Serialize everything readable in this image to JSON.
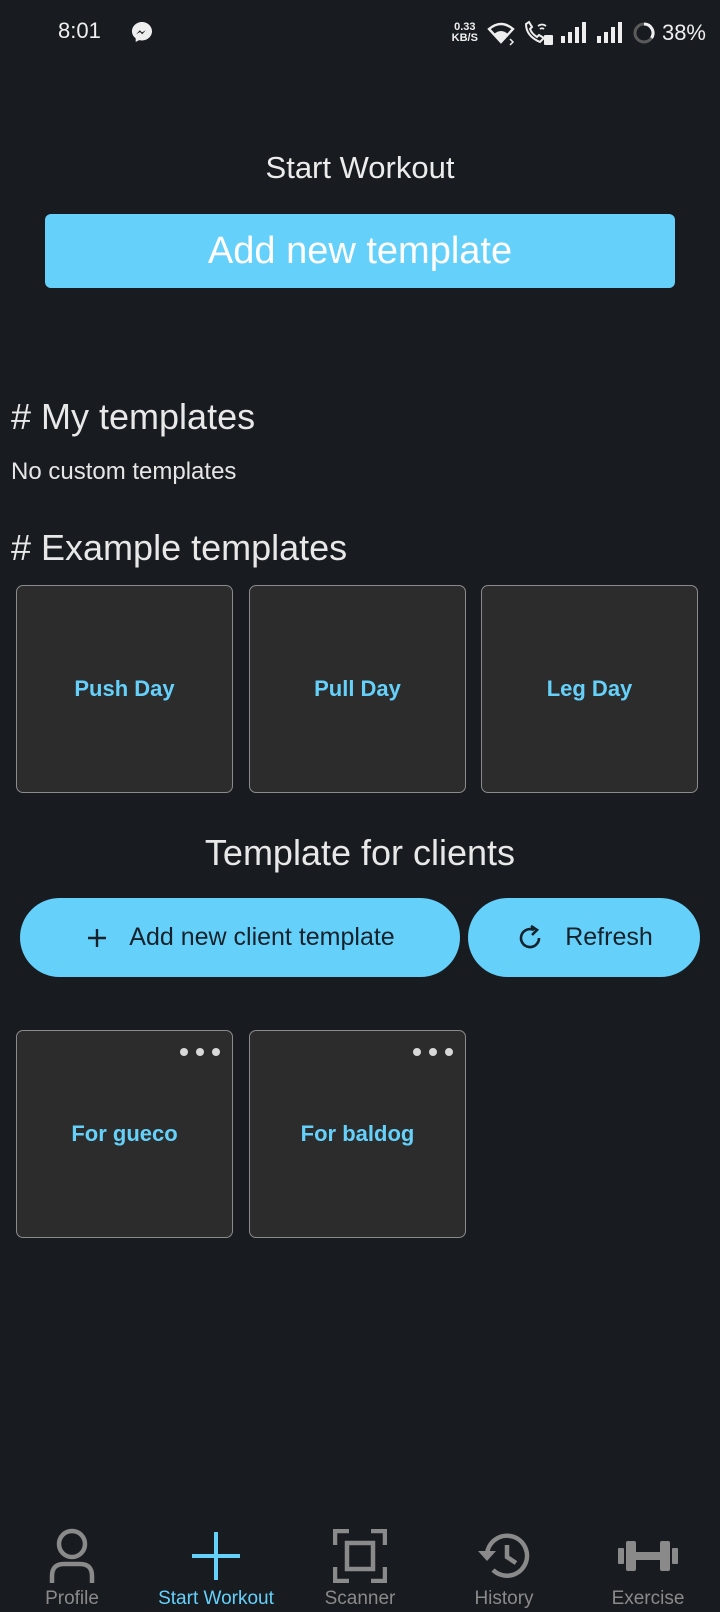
{
  "status_bar": {
    "time": "8:01",
    "net_speed_value": "0.33",
    "net_speed_unit": "KB/S",
    "battery_percent": "38%"
  },
  "header": {
    "title": "Start Workout",
    "add_template_label": "Add new template"
  },
  "my_templates": {
    "heading": "# My templates",
    "empty_text": "No custom templates"
  },
  "example_templates": {
    "heading": "# Example templates",
    "items": [
      {
        "label": "Push Day"
      },
      {
        "label": "Pull Day"
      },
      {
        "label": "Leg Day"
      }
    ]
  },
  "client_templates": {
    "heading": "Template for clients",
    "add_label": "Add new client template",
    "refresh_label": "Refresh",
    "items": [
      {
        "label": "For gueco"
      },
      {
        "label": "For baldog"
      }
    ]
  },
  "bottom_nav": {
    "items": [
      {
        "label": "Profile",
        "icon": "person-icon"
      },
      {
        "label": "Start Workout",
        "icon": "plus-icon",
        "active": true
      },
      {
        "label": "Scanner",
        "icon": "scanner-icon"
      },
      {
        "label": "History",
        "icon": "history-icon"
      },
      {
        "label": "Exercise",
        "icon": "dumbbell-icon"
      }
    ]
  },
  "colors": {
    "background": "#181b1f",
    "accent": "#65d1fb",
    "card_background": "#2c2c2c",
    "nav_inactive": "#8a8a8a"
  }
}
